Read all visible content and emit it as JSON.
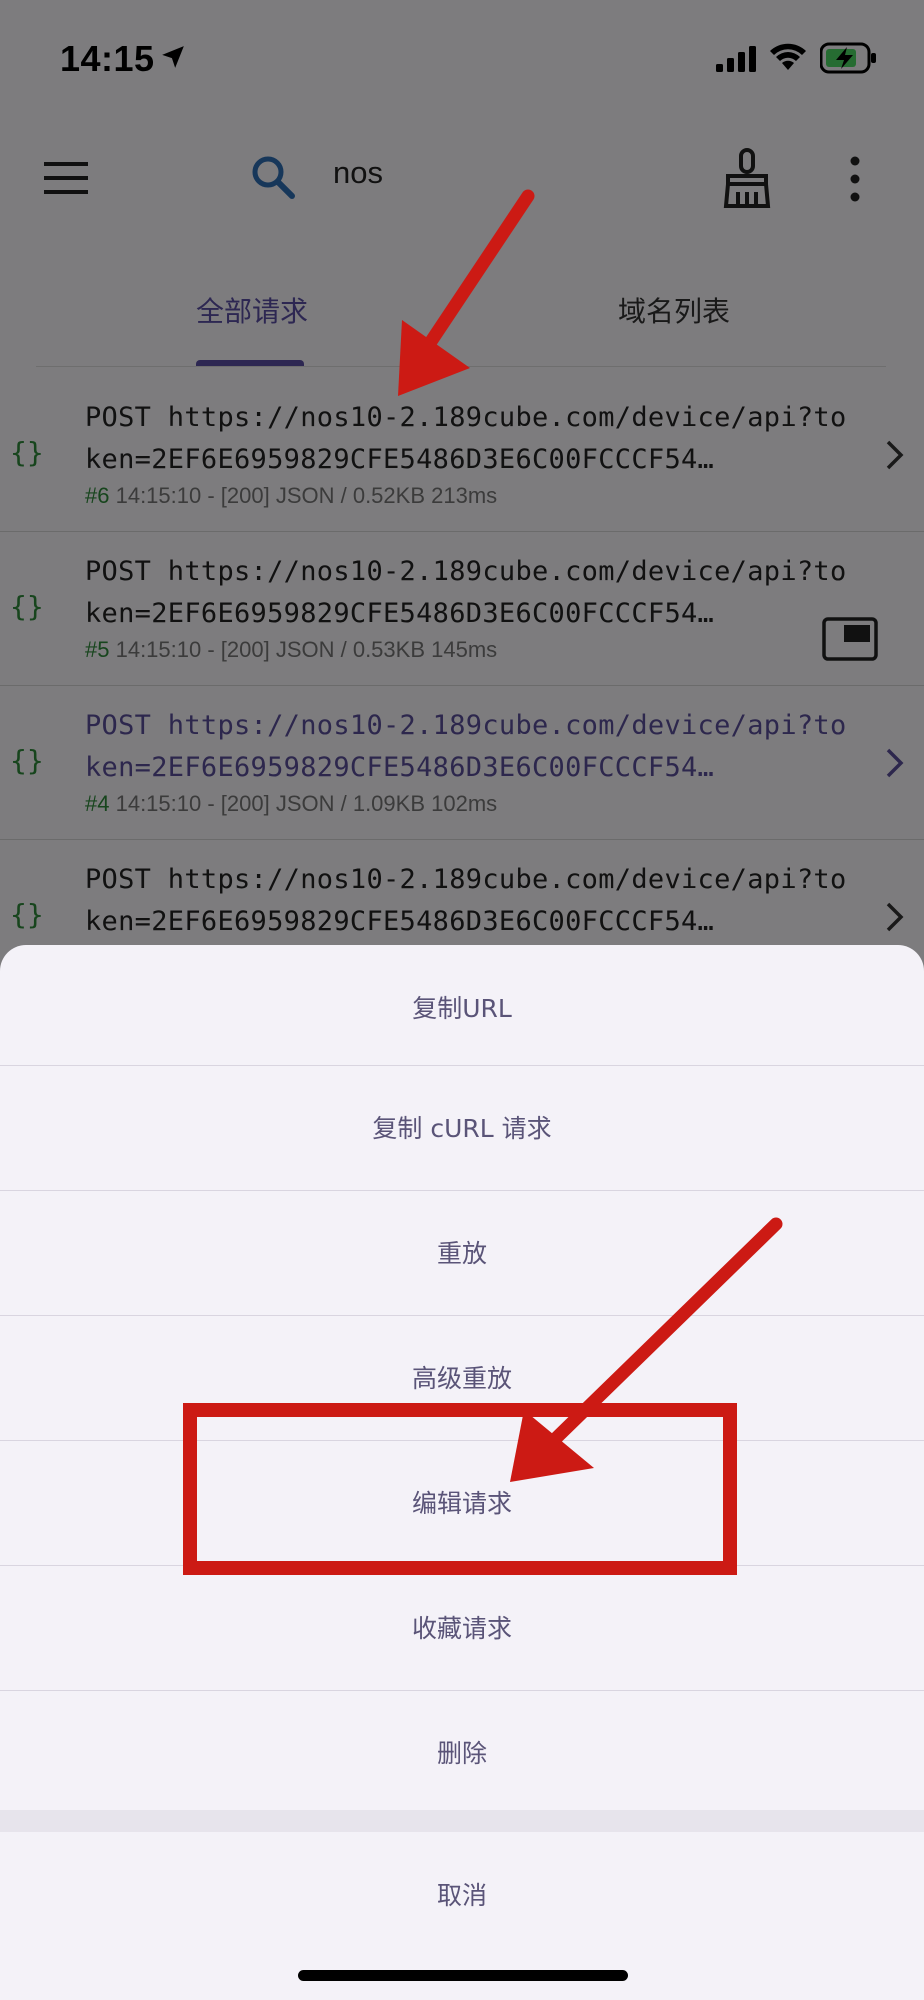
{
  "status_bar": {
    "time": "14:15",
    "icons": [
      "location-arrow-icon",
      "cellular-signal-icon",
      "wifi-icon",
      "battery-charging-icon"
    ]
  },
  "app_bar": {
    "search_query": "nos",
    "icons": [
      "menu-icon",
      "search-icon",
      "broom-icon",
      "more-vert-icon"
    ]
  },
  "tabs": [
    {
      "label": "全部请求",
      "selected": true
    },
    {
      "label": "域名列表",
      "selected": false
    }
  ],
  "requests": [
    {
      "line1": "POST https://nos10-2.189cube.com/device/api?to",
      "line2": "ken=2EF6E6959829CFE5486D3E6C00FCCCF54…",
      "index": "#6",
      "meta": " 14:15:10 - [200] JSON  / 0.52KB  213ms",
      "visited": false
    },
    {
      "line1": "POST https://nos10-2.189cube.com/device/api?to",
      "line2": "ken=2EF6E6959829CFE5486D3E6C00FCCCF54…",
      "index": "#5",
      "meta": " 14:15:10 - [200] JSON  / 0.53KB  145ms",
      "visited": false
    },
    {
      "line1": "POST https://nos10-2.189cube.com/device/api?to",
      "line2": "ken=2EF6E6959829CFE5486D3E6C00FCCCF54…",
      "index": "#4",
      "meta": " 14:15:10 - [200] JSON  / 1.09KB  102ms",
      "visited": true
    },
    {
      "line1": "POST https://nos10-2.189cube.com/device/api?to",
      "line2": "ken=2EF6E6959829CFE5486D3E6C00FCCCF54…",
      "index": "",
      "meta": "",
      "visited": false
    }
  ],
  "action_sheet": {
    "items": [
      "复制URL",
      "复制 cURL 请求",
      "重放",
      "高级重放",
      "编辑请求",
      "收藏请求",
      "删除"
    ],
    "cancel": "取消",
    "highlighted_item": "编辑请求"
  },
  "colors": {
    "accent": "#5b4fa5",
    "json_green": "#2e8b3a",
    "annotation_red": "#cc1a14"
  }
}
